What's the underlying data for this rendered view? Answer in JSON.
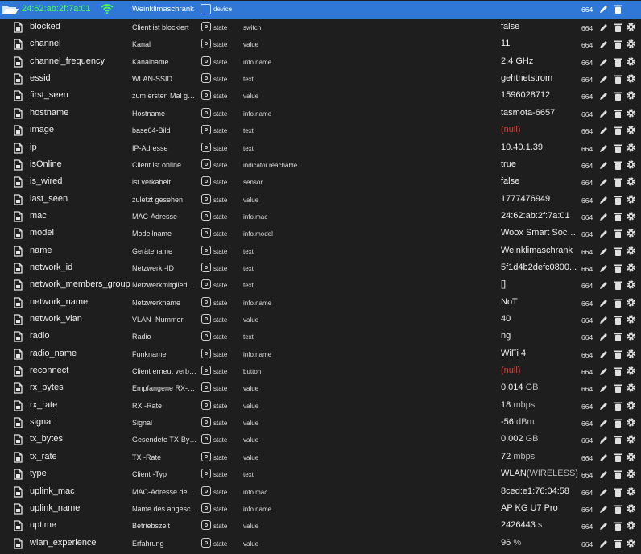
{
  "device": {
    "id": "24:62:ab:2f:7a:01",
    "name": "Weinklimaschrank",
    "role": "device",
    "acl": "664"
  },
  "states": [
    {
      "id": "blocked",
      "name": "Client ist blockiert",
      "type": "state",
      "role": "switch",
      "value": "false",
      "acl": "664",
      "null": false
    },
    {
      "id": "channel",
      "name": "Kanal",
      "type": "state",
      "role": "value",
      "value": "11",
      "acl": "664",
      "null": false
    },
    {
      "id": "channel_frequency",
      "name": "Kanalname",
      "type": "state",
      "role": "info.name",
      "value": "2.4 GHz",
      "acl": "664",
      "null": false
    },
    {
      "id": "essid",
      "name": "WLAN-SSID",
      "type": "state",
      "role": "text",
      "value": "gehtnetstrom",
      "acl": "664",
      "null": false
    },
    {
      "id": "first_seen",
      "name": "zum ersten Mal gesehen",
      "type": "state",
      "role": "value",
      "value": "1596028712",
      "acl": "664",
      "null": false
    },
    {
      "id": "hostname",
      "name": "Hostname",
      "type": "state",
      "role": "info.name",
      "value": "tasmota-6657",
      "acl": "664",
      "null": false
    },
    {
      "id": "image",
      "name": "base64-Bild",
      "type": "state",
      "role": "text",
      "value": "(null)",
      "acl": "664",
      "null": true
    },
    {
      "id": "ip",
      "name": "IP-Adresse",
      "type": "state",
      "role": "text",
      "value": "10.40.1.39",
      "acl": "664",
      "null": false
    },
    {
      "id": "isOnline",
      "name": "Client ist online",
      "type": "state",
      "role": "indicator.reachable",
      "value": "true",
      "acl": "664",
      "null": false
    },
    {
      "id": "is_wired",
      "name": "ist verkabelt",
      "type": "state",
      "role": "sensor",
      "value": "false",
      "acl": "664",
      "null": false
    },
    {
      "id": "last_seen",
      "name": "zuletzt gesehen",
      "type": "state",
      "role": "value",
      "value": "1777476949",
      "acl": "664",
      "null": false
    },
    {
      "id": "mac",
      "name": "MAC-Adresse",
      "type": "state",
      "role": "info.mac",
      "value": "24:62:ab:2f:7a:01",
      "acl": "664",
      "null": false
    },
    {
      "id": "model",
      "name": "Modellname",
      "type": "state",
      "role": "info.model",
      "value": "Woox Smart Socket",
      "acl": "664",
      "null": false
    },
    {
      "id": "name",
      "name": "Gerätename",
      "type": "state",
      "role": "text",
      "value": "Weinklimaschrank",
      "acl": "664",
      "null": false
    },
    {
      "id": "network_id",
      "name": "Netzwerk -ID",
      "type": "state",
      "role": "text",
      "value": "5f1d4b2defc0800...",
      "acl": "664",
      "null": false
    },
    {
      "id": "network_members_group",
      "name": "Netzwerkmitgliedergruppe",
      "type": "state",
      "role": "text",
      "value": "[]",
      "acl": "664",
      "null": false
    },
    {
      "id": "network_name",
      "name": "Netzwerkname",
      "type": "state",
      "role": "info.name",
      "value": "NoT",
      "acl": "664",
      "null": false
    },
    {
      "id": "network_vlan",
      "name": "VLAN -Nummer",
      "type": "state",
      "role": "value",
      "value": "40",
      "acl": "664",
      "null": false
    },
    {
      "id": "radio",
      "name": "Radio",
      "type": "state",
      "role": "text",
      "value": "ng",
      "acl": "664",
      "null": false
    },
    {
      "id": "radio_name",
      "name": "Funkname",
      "type": "state",
      "role": "info.name",
      "value": "WiFi 4",
      "acl": "664",
      "null": false
    },
    {
      "id": "reconnect",
      "name": "Client erneut verbinden",
      "type": "state",
      "role": "button",
      "value": "(null)",
      "acl": "664",
      "null": true
    },
    {
      "id": "rx_bytes",
      "name": "Empfangene RX-Bytes",
      "type": "state",
      "role": "value",
      "value": "0.014",
      "unit": "GB",
      "acl": "664",
      "null": false
    },
    {
      "id": "rx_rate",
      "name": "RX -Rate",
      "type": "state",
      "role": "value",
      "value": "18",
      "unit": "mbps",
      "acl": "664",
      "null": false
    },
    {
      "id": "signal",
      "name": "Signal",
      "type": "state",
      "role": "value",
      "value": "-56",
      "unit": "dBm",
      "acl": "664",
      "null": false
    },
    {
      "id": "tx_bytes",
      "name": "Gesendete TX-Bytes",
      "type": "state",
      "role": "value",
      "value": "0.002",
      "unit": "GB",
      "acl": "664",
      "null": false
    },
    {
      "id": "tx_rate",
      "name": "TX -Rate",
      "type": "state",
      "role": "value",
      "value": "72",
      "unit": "mbps",
      "acl": "664",
      "null": false
    },
    {
      "id": "type",
      "name": "Client -Typ",
      "type": "state",
      "role": "text",
      "value": "WLAN",
      "unit": "(WIRELESS)",
      "acl": "664",
      "null": false
    },
    {
      "id": "uplink_mac",
      "name": "MAC-Adresse des Uplinks",
      "type": "state",
      "role": "info.mac",
      "value": "8ced:e1:76:04:58",
      "acl": "664",
      "null": false
    },
    {
      "id": "uplink_name",
      "name": "Name des angeschlossenen Uplinks",
      "type": "state",
      "role": "info.name",
      "value": "AP KG U7 Pro",
      "acl": "664",
      "null": false
    },
    {
      "id": "uptime",
      "name": "Betriebszeit",
      "type": "state",
      "role": "value",
      "value": "2426443",
      "unit": "s",
      "acl": "664",
      "null": false
    },
    {
      "id": "wlan_experience",
      "name": "Erfahrung",
      "type": "state",
      "role": "value",
      "value": "96",
      "unit": "%",
      "acl": "664",
      "null": false
    }
  ],
  "colors": {
    "header_bg": "#2f78d8",
    "device_id": "#4cff4c",
    "null_value": "#e0403a",
    "background": "#1e1e1e"
  },
  "icons": {
    "folder": "folder-open-icon",
    "wifi": "wifi-icon",
    "file": "file-icon",
    "state": "state-icon",
    "edit": "pencil-icon",
    "delete": "trash-icon",
    "settings": "gear-icon"
  }
}
